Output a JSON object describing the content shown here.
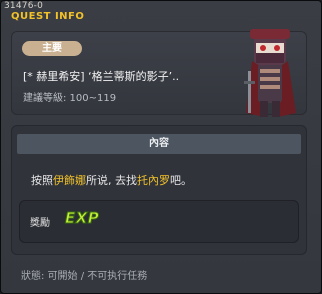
{
  "header": {
    "quest_id": "31476-0",
    "title": "QUEST INFO"
  },
  "quest": {
    "type_badge": "主要",
    "name": "[* 赫里希安] ‘格兰蒂斯的影子’..",
    "level": "建議等級: 100~119"
  },
  "content": {
    "heading": "內容",
    "desc_before": "按照",
    "desc_npc1": "伊飾娜",
    "desc_middle": "所说, 去找",
    "desc_npc2": "托內罗",
    "desc_after": "吧。"
  },
  "reward": {
    "label": "獎勵",
    "exp_text": "EXP"
  },
  "status": {
    "text": "狀態: 可開始 / 不可执行任務"
  },
  "colors": {
    "title": "#f2c22a",
    "highlight": "#f2c22a",
    "badge": "#c8b090",
    "exp": "#c4f03a"
  },
  "icons": {
    "npc": "npc-ninja-portrait",
    "exp": "exp-icon"
  }
}
